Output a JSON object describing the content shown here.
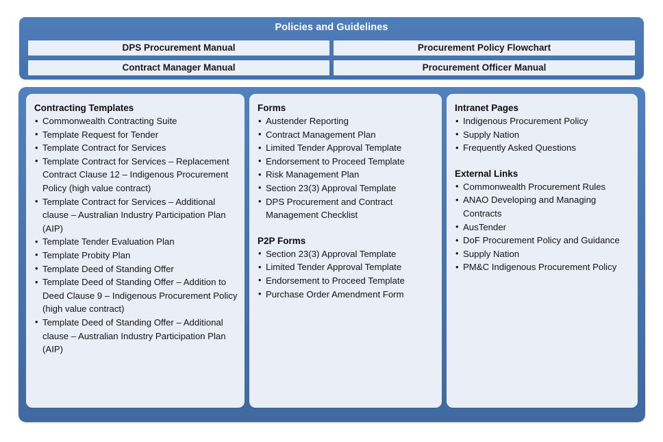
{
  "header": {
    "title": "Policies and Guidelines",
    "buttons": [
      {
        "label": "DPS Procurement Manual"
      },
      {
        "label": "Procurement Policy Flowchart"
      },
      {
        "label": "Contract Manager Manual"
      },
      {
        "label": "Procurement Officer Manual"
      }
    ]
  },
  "colors": {
    "panel_blue": "#4A77B3",
    "card_background": "#E9EEF7",
    "button_background": "#EAEFF8",
    "title_text": "#FFFFFF",
    "body_text": "#141414"
  },
  "columns": [
    {
      "sections": [
        {
          "heading": "Contracting Templates",
          "items": [
            "Commonwealth Contracting Suite",
            "Template Request for Tender",
            "Template Contract for Services",
            "Template Contract for Services – Replacement Contract Clause 12 – Indigenous Procurement Policy (high value contract)",
            "Template Contract for Services – Additional clause – Australian Industry Participation Plan (AIP)",
            "Template Tender Evaluation Plan",
            "Template Probity Plan",
            "Template Deed of Standing Offer",
            "Template Deed of Standing Offer – Addition to Deed Clause 9 – Indigenous Procurement Policy (high value contract)",
            "Template Deed of Standing Offer – Additional clause – Australian Industry Participation Plan (AIP)"
          ]
        }
      ]
    },
    {
      "sections": [
        {
          "heading": "Forms",
          "items": [
            "Austender Reporting",
            "Contract Management Plan",
            "Limited Tender Approval Template",
            "Endorsement to Proceed Template",
            "Risk Management Plan",
            "Section 23(3) Approval Template",
            "DPS Procurement and Contract Management Checklist"
          ]
        },
        {
          "heading": "P2P Forms",
          "items": [
            "Section 23(3) Approval Template",
            "Limited Tender Approval Template",
            "Endorsement to Proceed Template",
            "Purchase Order Amendment Form"
          ]
        }
      ]
    },
    {
      "sections": [
        {
          "heading": "Intranet Pages",
          "items": [
            "Indigenous Procurement Policy",
            "Supply Nation",
            "Frequently Asked Questions"
          ]
        },
        {
          "heading": "External Links",
          "items": [
            "Commonwealth Procurement Rules",
            "ANAO Developing and Managing Contracts",
            "AusTender",
            "DoF Procurement Policy and Guidance",
            "Supply Nation",
            "PM&C Indigenous Procurement Policy"
          ]
        }
      ]
    }
  ]
}
